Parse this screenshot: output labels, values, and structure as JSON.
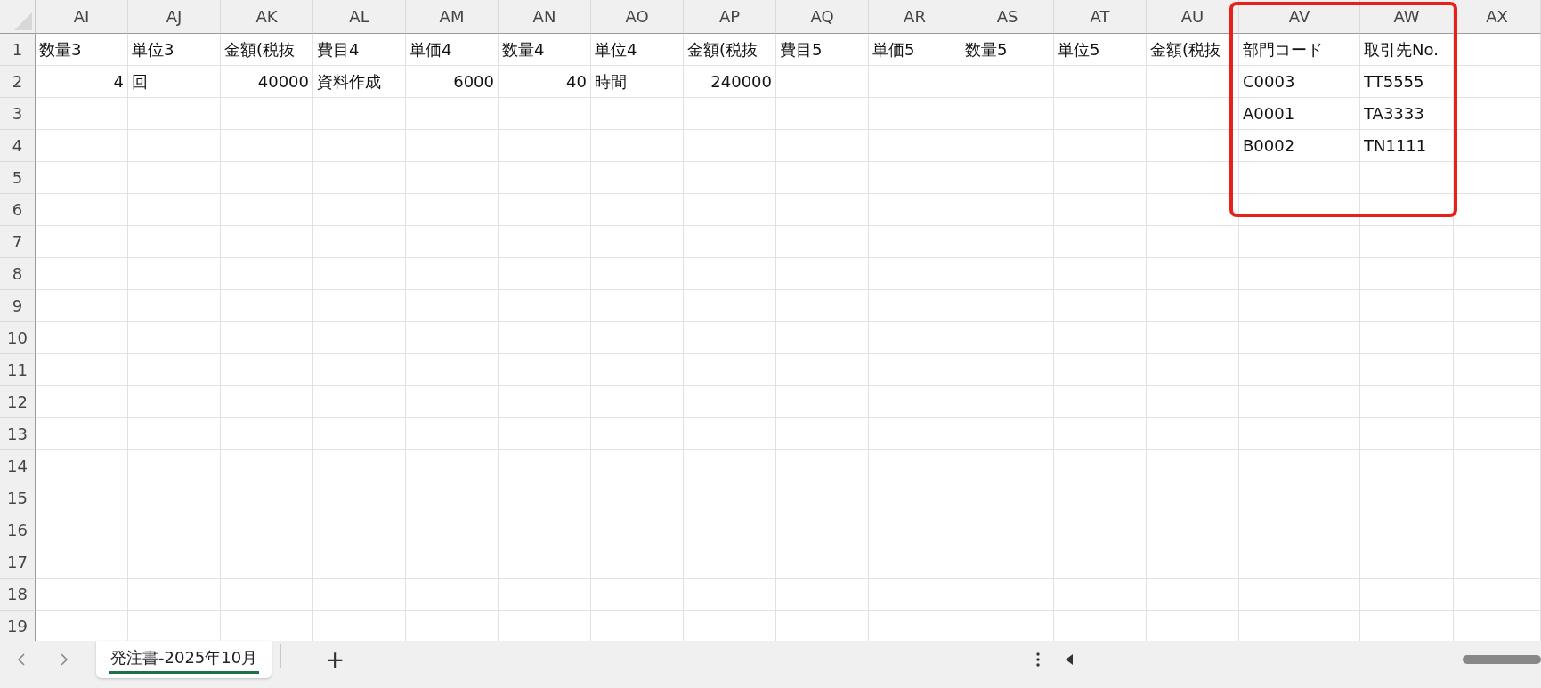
{
  "columns": [
    "AI",
    "AJ",
    "AK",
    "AL",
    "AM",
    "AN",
    "AO",
    "AP",
    "AQ",
    "AR",
    "AS",
    "AT",
    "AU",
    "AV",
    "AW",
    "AX"
  ],
  "rows": [
    {
      "number": "1",
      "cells": [
        {
          "text": "数量3",
          "kind": "text"
        },
        {
          "text": "単位3",
          "kind": "text"
        },
        {
          "text": "金額(税抜",
          "kind": "text"
        },
        {
          "text": "費目4",
          "kind": "text"
        },
        {
          "text": "単価4",
          "kind": "text"
        },
        {
          "text": "数量4",
          "kind": "text"
        },
        {
          "text": "単位4",
          "kind": "text"
        },
        {
          "text": "金額(税抜",
          "kind": "text"
        },
        {
          "text": "費目5",
          "kind": "text"
        },
        {
          "text": "単価5",
          "kind": "text"
        },
        {
          "text": "数量5",
          "kind": "text"
        },
        {
          "text": "単位5",
          "kind": "text"
        },
        {
          "text": "金額(税抜",
          "kind": "text"
        },
        {
          "text": "部門コード",
          "kind": "text"
        },
        {
          "text": "取引先No.",
          "kind": "text"
        },
        null
      ]
    },
    {
      "number": "2",
      "cells": [
        {
          "text": "4",
          "kind": "number"
        },
        {
          "text": "回",
          "kind": "text"
        },
        {
          "text": "40000",
          "kind": "number"
        },
        {
          "text": "資料作成",
          "kind": "text"
        },
        {
          "text": "6000",
          "kind": "number"
        },
        {
          "text": "40",
          "kind": "number"
        },
        {
          "text": "時間",
          "kind": "text"
        },
        {
          "text": "240000",
          "kind": "number"
        },
        null,
        null,
        null,
        null,
        null,
        {
          "text": "C0003",
          "kind": "text"
        },
        {
          "text": "TT5555",
          "kind": "text"
        },
        null
      ]
    },
    {
      "number": "3",
      "cells": [
        null,
        null,
        null,
        null,
        null,
        null,
        null,
        null,
        null,
        null,
        null,
        null,
        null,
        {
          "text": "A0001",
          "kind": "text"
        },
        {
          "text": "TA3333",
          "kind": "text"
        },
        null
      ]
    },
    {
      "number": "4",
      "cells": [
        null,
        null,
        null,
        null,
        null,
        null,
        null,
        null,
        null,
        null,
        null,
        null,
        null,
        {
          "text": "B0002",
          "kind": "text"
        },
        {
          "text": "TN1111",
          "kind": "text"
        },
        null
      ]
    },
    {
      "number": "5",
      "cells": []
    },
    {
      "number": "6",
      "cells": []
    },
    {
      "number": "7",
      "cells": []
    },
    {
      "number": "8",
      "cells": []
    },
    {
      "number": "9",
      "cells": []
    },
    {
      "number": "10",
      "cells": []
    },
    {
      "number": "11",
      "cells": []
    },
    {
      "number": "12",
      "cells": []
    },
    {
      "number": "13",
      "cells": []
    },
    {
      "number": "14",
      "cells": []
    },
    {
      "number": "15",
      "cells": []
    },
    {
      "number": "16",
      "cells": []
    },
    {
      "number": "17",
      "cells": []
    },
    {
      "number": "18",
      "cells": []
    },
    {
      "number": "19",
      "cells": []
    }
  ],
  "sheet_tabs": [
    {
      "label": "発注書-2025年10月",
      "selected": true
    }
  ],
  "add_sheet": "+"
}
